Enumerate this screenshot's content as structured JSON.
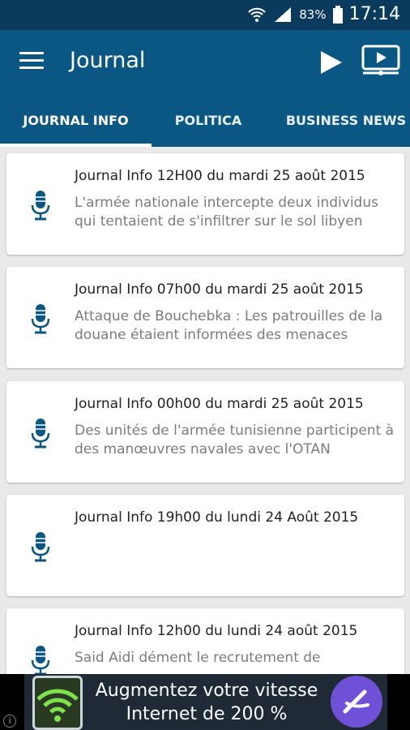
{
  "status_bar": {
    "battery": "83%",
    "time": "17:14"
  },
  "app_bar": {
    "title": "Journal"
  },
  "tabs": [
    {
      "label": "JOURNAL INFO",
      "selected": true
    },
    {
      "label": "POLITICA",
      "selected": false
    },
    {
      "label": "BUSINESS NEWS",
      "selected": false
    }
  ],
  "items": [
    {
      "title": "Journal Info 12H00 du mardi 25 août 2015",
      "summary": "L'armée nationale intercepte deux individus qui tentaient de s'infiltrer sur le sol libyen"
    },
    {
      "title": "Journal Info 07h00 du mardi 25 août 2015",
      "summary": "Attaque de Bouchebka : Les patrouilles de la douane étaient informées des menaces"
    },
    {
      "title": "Journal Info 00h00 du mardi 25 août 2015",
      "summary": "Des unités de l'armée tunisienne participent à des manœuvres navales avec l'OTAN"
    },
    {
      "title": "Journal Info 19h00 du lundi 24 Août 2015",
      "summary": ""
    },
    {
      "title": "Journal Info 12h00 du lundi 24 août 2015",
      "summary": "Said Aidi dément le recrutement de"
    }
  ],
  "ad": {
    "line1": "Augmentez votre vitesse",
    "line2": "Internet de 200 %",
    "info_icon": "i"
  },
  "colors": {
    "app_bar": "#0b5784",
    "status_bar": "#0a3a5c",
    "mic": "#0b5784"
  }
}
